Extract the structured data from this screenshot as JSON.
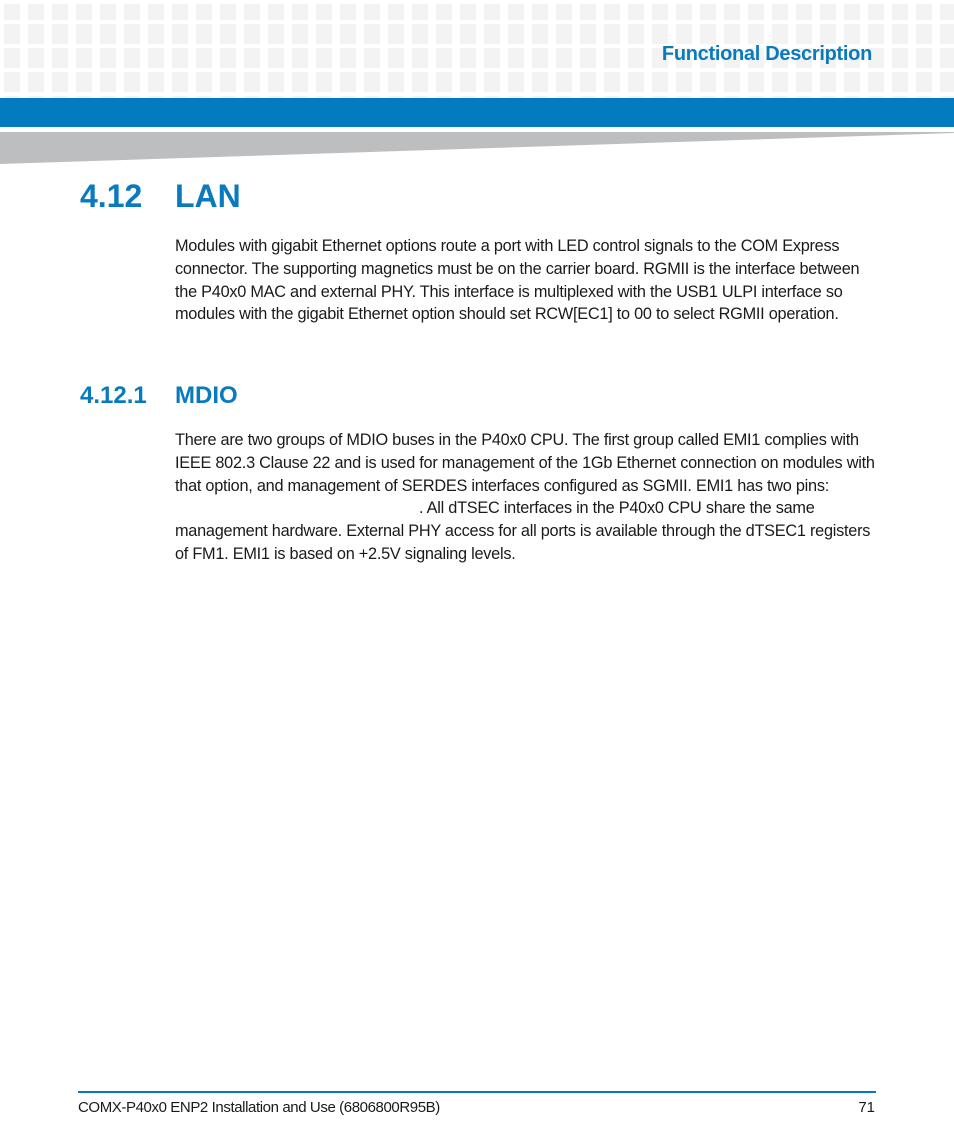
{
  "header": {
    "section_title": "Functional Description"
  },
  "section": {
    "number": "4.12",
    "title": "LAN",
    "body": "Modules with gigabit Ethernet options route a port with LED control signals to the COM Express connector. The supporting magnetics must be on the carrier board. RGMII is the interface between the P40x0 MAC and external PHY. This interface is multiplexed with the USB1 ULPI interface so modules with the gigabit Ethernet option should set RCW[EC1] to 00 to select RGMII operation."
  },
  "subsection": {
    "number": "4.12.1",
    "title": "MDIO",
    "body_before": "There are two groups of MDIO buses in the P40x0 CPU. The first group called EMI1 complies with IEEE 802.3 Clause 22 and is used for management of the 1Gb Ethernet connection on modules with that option, and management of SERDES interfaces configured as SGMII. EMI1 has two pins:",
    "body_after": ". All dTSEC interfaces in the P40x0 CPU share the same management hardware. External PHY access for all ports is available through the dTSEC1 registers of FM1. EMI1 is based on +2.5V signaling levels."
  },
  "footer": {
    "document": "COMX-P40x0 ENP2 Installation and Use (6806800R95B)",
    "page_number": "71"
  },
  "colors": {
    "accent": "#037cbf",
    "heading": "#0a7abf",
    "wedge": "#bdbec0"
  }
}
